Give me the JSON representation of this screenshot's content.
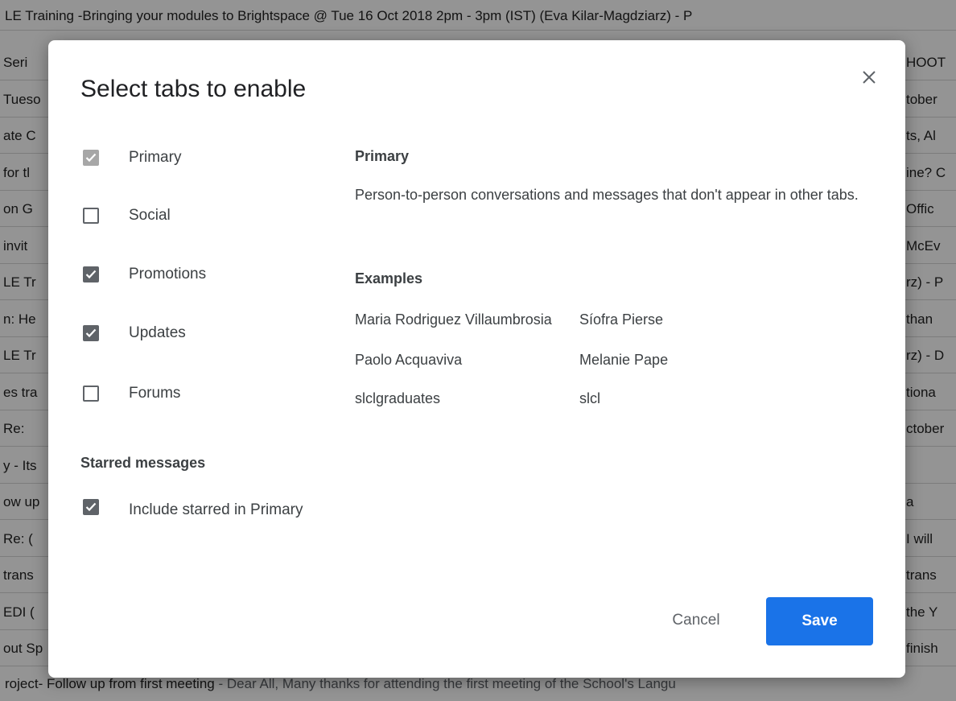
{
  "inbox": {
    "top_row": "LE Training -Bringing your modules to Brightspace @ Tue 16 Oct 2018 2pm - 3pm (IST) (Eva Kilar-Magdziarz) - P",
    "bottom_row_subject": "roject- Follow up from first meeting",
    "bottom_row_snippet": " - Dear All, Many thanks for attending the first meeting of the School's Langu",
    "left_fragments": [
      "Seri",
      "Tueso",
      "ate C",
      "for tl",
      "on G",
      "invit",
      "LE Tr",
      "n: He",
      "LE Tr",
      "es tra",
      "Re:",
      "y - Its",
      "ow up",
      "Re: (",
      "trans",
      "EDI (",
      "out Sp"
    ],
    "right_fragments": [
      "HOOT",
      "tober",
      "ts, Al",
      "ine? C",
      "Offic",
      "McEv",
      "rz) - P",
      "than",
      "rz) - D",
      "tiona",
      "ctober",
      "",
      "a",
      "I will",
      "trans",
      "the Y",
      "finish"
    ]
  },
  "dialog": {
    "title": "Select tabs to enable",
    "close_icon": "close-icon",
    "tabs": [
      {
        "label": "Primary",
        "state": "checked-disabled"
      },
      {
        "label": "Social",
        "state": "unchecked"
      },
      {
        "label": "Promotions",
        "state": "checked"
      },
      {
        "label": "Updates",
        "state": "checked"
      },
      {
        "label": "Forums",
        "state": "unchecked"
      }
    ],
    "starred": {
      "section_label": "Starred messages",
      "option_label": "Include starred in Primary",
      "checked": true
    },
    "description": {
      "title": "Primary",
      "text": "Person-to-person conversations and messages that don't appear in other tabs.",
      "examples_label": "Examples",
      "examples": [
        "Maria Rodriguez Villaumbrosia",
        "Síofra Pierse",
        "Paolo Acquaviva",
        "Melanie Pape",
        "slclgraduates",
        "slcl"
      ]
    },
    "cancel_label": "Cancel",
    "save_label": "Save",
    "colors": {
      "accent": "#1a73e8",
      "checkbox": "#5f6368",
      "checkbox_disabled": "#a7a7a7"
    }
  }
}
